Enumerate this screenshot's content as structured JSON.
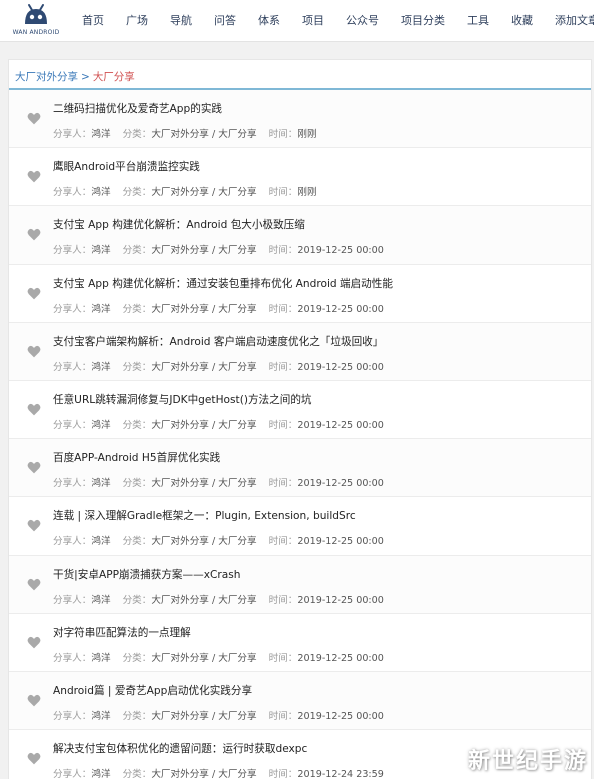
{
  "header": {
    "logo_text": "WAN ANDROID",
    "nav": [
      {
        "label": "首页"
      },
      {
        "label": "广场"
      },
      {
        "label": "导航"
      },
      {
        "label": "问答"
      },
      {
        "label": "体系"
      },
      {
        "label": "项目"
      },
      {
        "label": "公众号"
      },
      {
        "label": "项目分类"
      },
      {
        "label": "工具"
      },
      {
        "label": "收藏"
      },
      {
        "label": "添加文章"
      }
    ]
  },
  "breadcrumb": {
    "parent": "大厂对外分享",
    "separator": ">",
    "current": "大厂分享"
  },
  "labels": {
    "sharer": "分享人：",
    "category": "分类：",
    "time": "时间："
  },
  "articles": [
    {
      "title": "二维码扫描优化及爱奇艺App的实践",
      "sharer": "鸿洋",
      "category": "大厂对外分享 / 大厂分享",
      "time": "刚刚"
    },
    {
      "title": "鹰眼Android平台崩溃监控实践",
      "sharer": "鸿洋",
      "category": "大厂对外分享 / 大厂分享",
      "time": "刚刚"
    },
    {
      "title": "支付宝 App 构建优化解析：Android 包大小极致压缩",
      "sharer": "鸿洋",
      "category": "大厂对外分享 / 大厂分享",
      "time": "2019-12-25 00:00"
    },
    {
      "title": "支付宝 App 构建优化解析：通过安装包重排布优化 Android 端启动性能",
      "sharer": "鸿洋",
      "category": "大厂对外分享 / 大厂分享",
      "time": "2019-12-25 00:00"
    },
    {
      "title": "支付宝客户端架构解析：Android 客户端启动速度优化之「垃圾回收」",
      "sharer": "鸿洋",
      "category": "大厂对外分享 / 大厂分享",
      "time": "2019-12-25 00:00"
    },
    {
      "title": "任意URL跳转漏洞修复与JDK中getHost()方法之间的坑",
      "sharer": "鸿洋",
      "category": "大厂对外分享 / 大厂分享",
      "time": "2019-12-25 00:00"
    },
    {
      "title": "百度APP-Android H5首屏优化实践",
      "sharer": "鸿洋",
      "category": "大厂对外分享 / 大厂分享",
      "time": "2019-12-25 00:00"
    },
    {
      "title": "连载 | 深入理解Gradle框架之一：Plugin, Extension, buildSrc",
      "sharer": "鸿洋",
      "category": "大厂对外分享 / 大厂分享",
      "time": "2019-12-25 00:00"
    },
    {
      "title": "干货|安卓APP崩溃捕获方案——xCrash",
      "sharer": "鸿洋",
      "category": "大厂对外分享 / 大厂分享",
      "time": "2019-12-25 00:00"
    },
    {
      "title": "对字符串匹配算法的一点理解",
      "sharer": "鸿洋",
      "category": "大厂对外分享 / 大厂分享",
      "time": "2019-12-25 00:00"
    },
    {
      "title": "Android篇 | 爱奇艺App启动优化实践分享",
      "sharer": "鸿洋",
      "category": "大厂对外分享 / 大厂分享",
      "time": "2019-12-25 00:00"
    },
    {
      "title": "解决支付宝包体积优化的遗留问题：运行时获取dexpc",
      "sharer": "鸿洋",
      "category": "大厂对外分享 / 大厂分享",
      "time": "2019-12-24 23:59"
    }
  ],
  "watermark": "新世纪手游"
}
